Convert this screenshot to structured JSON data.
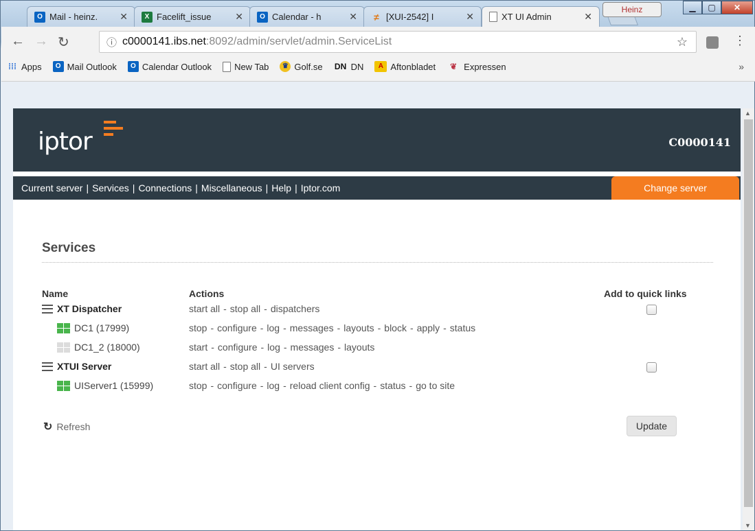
{
  "browser": {
    "user_label": "Heinz",
    "tabs": [
      {
        "icon": "outlook-icon",
        "title": "Mail - heinz.",
        "active": false
      },
      {
        "icon": "excel-icon",
        "title": "Facelift_issue",
        "active": false
      },
      {
        "icon": "outlook-icon",
        "title": "Calendar - h",
        "active": false
      },
      {
        "icon": "jira-icon",
        "title": "[XUI-2542] I",
        "active": false
      },
      {
        "icon": "page-icon",
        "title": "XT UI Admin",
        "active": true
      }
    ],
    "url_host": "c0000141.ibs.net",
    "url_rest": ":8092/admin/servlet/admin.ServiceList",
    "bookmarks": [
      "Apps",
      "Mail Outlook",
      "Calendar Outlook",
      "New Tab",
      "Golf.se",
      "DN",
      "Aftonbladet",
      "Expressen"
    ],
    "overflow_label": "»"
  },
  "page": {
    "logo_text": "iptor",
    "server_id": "C0000141",
    "nav": [
      "Current server",
      "Services",
      "Connections",
      "Miscellaneous",
      "Help",
      "Iptor.com"
    ],
    "change_server": "Change server",
    "section_title": "Services",
    "columns": {
      "name": "Name",
      "actions": "Actions",
      "quick": "Add to quick links"
    },
    "rows": [
      {
        "type": "group",
        "name": "XT Dispatcher",
        "actions": [
          "start all",
          "stop all",
          "dispatchers"
        ],
        "quick_link": false
      },
      {
        "type": "item",
        "status": "running",
        "name": "DC1 (17999)",
        "actions": [
          "stop",
          "configure",
          "log",
          "messages",
          "layouts",
          "block",
          "apply",
          "status"
        ]
      },
      {
        "type": "item",
        "status": "stopped",
        "name": "DC1_2 (18000)",
        "actions": [
          "start",
          "configure",
          "log",
          "messages",
          "layouts"
        ]
      },
      {
        "type": "group",
        "name": "XTUI Server",
        "actions": [
          "start all",
          "stop all",
          "UI servers"
        ],
        "quick_link": false
      },
      {
        "type": "item",
        "status": "running",
        "name": "UIServer1 (15999)",
        "actions": [
          "stop",
          "configure",
          "log",
          "reload client config",
          "status",
          "go to site"
        ]
      }
    ],
    "refresh_label": "Refresh",
    "update_label": "Update"
  },
  "colors": {
    "header_bg": "#2d3b45",
    "accent": "#f47c20",
    "running": "#49b54c",
    "stopped": "#dcdcdc"
  }
}
